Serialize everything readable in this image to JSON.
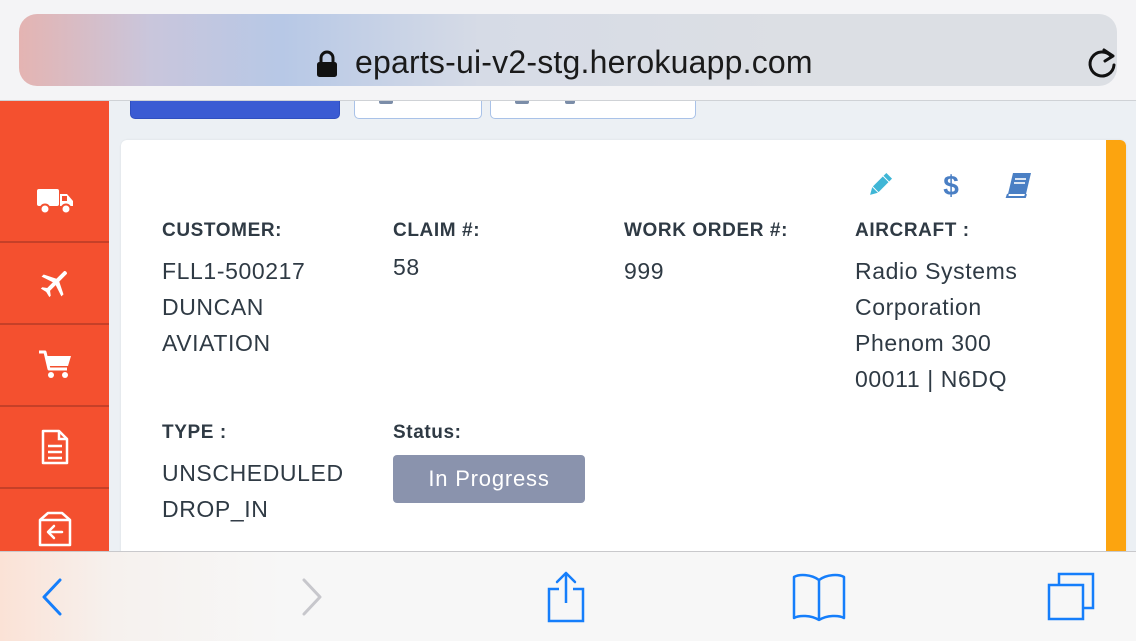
{
  "browser": {
    "url": "eparts-ui-v2-stg.herokuapp.com",
    "icons": [
      "lock-icon",
      "reload-icon",
      "back-icon",
      "forward-icon",
      "share-icon",
      "bookmarks-icon",
      "tabs-icon"
    ],
    "accent": "#157efb"
  },
  "sidebar": {
    "color": "#f4502f",
    "items": [
      {
        "icon": "truck-icon"
      },
      {
        "icon": "airplane-icon"
      },
      {
        "icon": "cart-icon"
      },
      {
        "icon": "document-icon"
      },
      {
        "icon": "return-box-icon"
      }
    ]
  },
  "card": {
    "actions": [
      "edit-icon",
      "dollar-icon",
      "book-icon"
    ],
    "accent_color": "#fca40f",
    "customer": {
      "label": "CUSTOMER:",
      "lines": [
        "FLL1-500217",
        "DUNCAN",
        "AVIATION"
      ]
    },
    "claim": {
      "label": "CLAIM #:",
      "value": "58"
    },
    "work_order": {
      "label": "WORK ORDER #:",
      "value": "999"
    },
    "aircraft": {
      "label": "AIRCRAFT :",
      "lines": [
        "Radio Systems",
        "Corporation",
        "Phenom 300",
        "00011 | N6DQ"
      ]
    },
    "type": {
      "label": "TYPE :",
      "lines": [
        "UNSCHEDULED",
        "DROP_IN"
      ]
    },
    "status": {
      "label": "Status:",
      "value": "In Progress",
      "color": "#8a93ad"
    }
  }
}
